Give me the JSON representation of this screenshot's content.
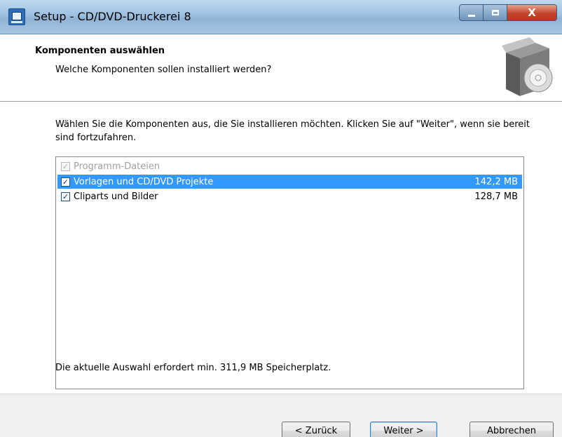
{
  "window": {
    "title": "Setup - CD/DVD-Druckerei 8",
    "app_icon": "setup-app-icon",
    "caption_buttons": {
      "close_label": "X"
    }
  },
  "header": {
    "title": "Komponenten auswählen",
    "subtitle": "Welche Komponenten sollen installiert werden?",
    "icon": "software-box-icon"
  },
  "content": {
    "intro": "Wählen Sie die Komponenten aus, die Sie installieren möchten. Klicken Sie auf \"Weiter\", wenn sie bereit sind fortzufahren.",
    "components": [
      {
        "label": "Programm-Dateien",
        "size": "",
        "checked": true,
        "disabled": true,
        "selected": false
      },
      {
        "label": "Vorlagen und CD/DVD Projekte",
        "size": "142,2 MB",
        "checked": true,
        "disabled": false,
        "selected": true
      },
      {
        "label": "Cliparts und Bilder",
        "size": "128,7 MB",
        "checked": true,
        "disabled": false,
        "selected": false
      }
    ],
    "space_required": "Die aktuelle Auswahl erfordert min. 311,9 MB Speicherplatz."
  },
  "buttons": {
    "back": "< Zurück",
    "next": "Weiter >",
    "cancel": "Abbrechen"
  },
  "colors": {
    "selection": "#3399ff",
    "titlebar": "#9dc0e1"
  }
}
